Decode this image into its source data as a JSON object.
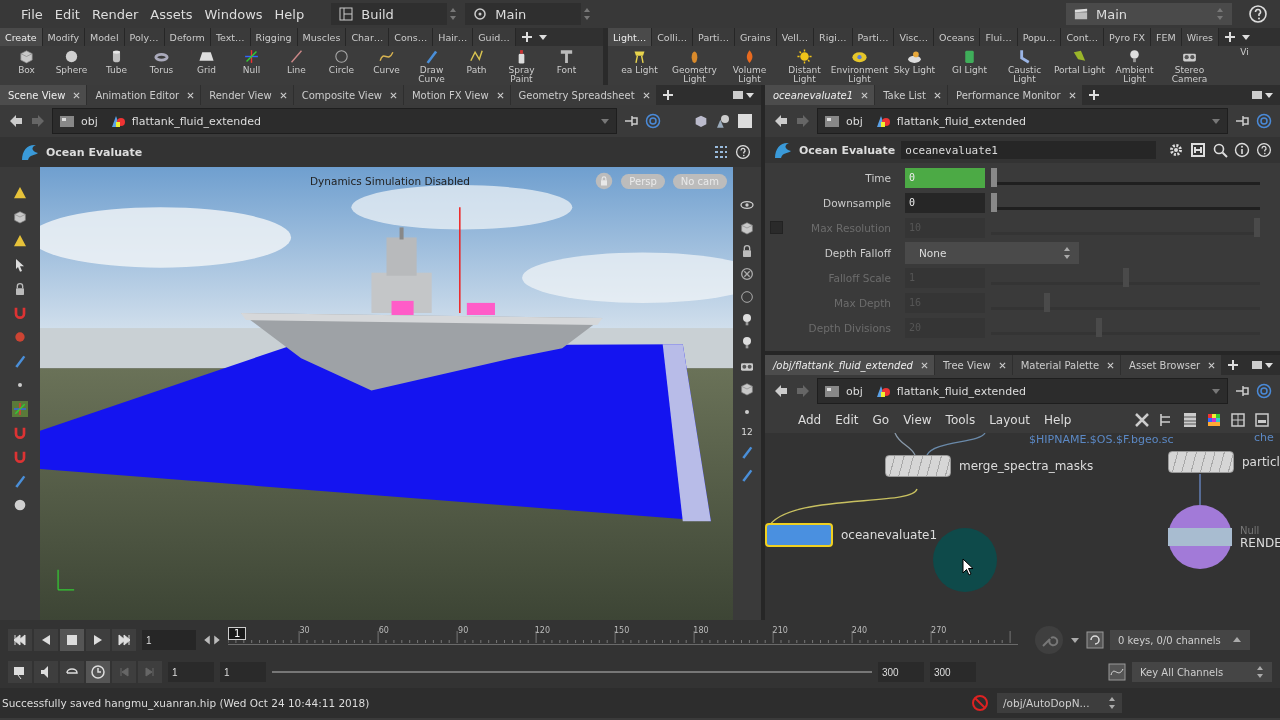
{
  "menubar": {
    "items": [
      "File",
      "Edit",
      "Render",
      "Assets",
      "Windows",
      "Help"
    ],
    "desktop": "Build",
    "scene_view_set": "Main",
    "context": "Main"
  },
  "shelves": [
    {
      "tabs": [
        {
          "label": "Create",
          "selected": true
        },
        {
          "label": "Modify",
          "selected": false
        },
        {
          "label": "Model",
          "selected": false
        },
        {
          "label": "Poly…",
          "selected": false
        },
        {
          "label": "Deform",
          "selected": false
        },
        {
          "label": "Text…",
          "selected": false
        },
        {
          "label": "Rigging",
          "selected": false
        },
        {
          "label": "Muscles",
          "selected": false
        },
        {
          "label": "Char…",
          "selected": false
        },
        {
          "label": "Cons…",
          "selected": false
        },
        {
          "label": "Hair…",
          "selected": false
        },
        {
          "label": "Guid…",
          "selected": false
        }
      ],
      "tools": [
        "Box",
        "Sphere",
        "Tube",
        "Torus",
        "Grid",
        "Null",
        "Line",
        "Circle",
        "Curve",
        "Draw Curve",
        "Path",
        "Spray Paint",
        "Font"
      ]
    },
    {
      "tabs": [
        {
          "label": "Light…",
          "selected": true
        },
        {
          "label": "Colli…",
          "selected": false
        },
        {
          "label": "Parti…",
          "selected": false
        },
        {
          "label": "Grains",
          "selected": false
        },
        {
          "label": "Vell…",
          "selected": false
        },
        {
          "label": "Rigi…",
          "selected": false
        },
        {
          "label": "Parti…",
          "selected": false
        },
        {
          "label": "Visc…",
          "selected": false
        },
        {
          "label": "Oceans",
          "selected": false
        },
        {
          "label": "Flui…",
          "selected": false
        },
        {
          "label": "Popu…",
          "selected": false
        },
        {
          "label": "Cont…",
          "selected": false
        },
        {
          "label": "Pyro FX",
          "selected": false
        },
        {
          "label": "FEM",
          "selected": false
        },
        {
          "label": "Wires",
          "selected": false
        }
      ],
      "tools": [
        "ea Light",
        "Geometry Light",
        "Volume Light",
        "Distant Light",
        "Environment Light",
        "Sky Light",
        "GI Light",
        "Caustic Light",
        "Portal Light",
        "Ambient Light",
        "Stereo Camera",
        "Vi"
      ]
    }
  ],
  "scene_pane": {
    "tabs": [
      {
        "label": "Scene View",
        "selected": true
      },
      {
        "label": "Animation Editor",
        "selected": false
      },
      {
        "label": "Render View",
        "selected": false
      },
      {
        "label": "Composite View",
        "selected": false
      },
      {
        "label": "Motion FX View",
        "selected": false
      },
      {
        "label": "Geometry Spreadsheet",
        "selected": false
      }
    ],
    "path": [
      "obj",
      "flattank_fluid_extended"
    ],
    "node_type": "Ocean Evaluate",
    "overlay": "Dynamics Simulation Disabled",
    "camera_menu": "Persp",
    "cam_menu": "No cam",
    "snap_count": "12"
  },
  "param_pane": {
    "tabs": [
      {
        "label": "oceanevaluate1",
        "selected": true
      },
      {
        "label": "Take List",
        "selected": false
      },
      {
        "label": "Performance Monitor",
        "selected": false
      }
    ],
    "path": [
      "obj",
      "flattank_fluid_extended"
    ],
    "node_type": "Ocean Evaluate",
    "node_name": "oceanevaluate1",
    "params": [
      {
        "kind": "slider",
        "label": "Time",
        "value": "0",
        "level": 0,
        "disabled": false,
        "keyed": true
      },
      {
        "kind": "slider",
        "label": "Downsample",
        "value": "0",
        "level": 0,
        "disabled": false,
        "keyed": false
      },
      {
        "kind": "toggle_slider",
        "label": "Max Resolution",
        "value": "10",
        "level": 1,
        "disabled": true,
        "keyed": false,
        "checked": false
      },
      {
        "kind": "menu",
        "label": "Depth Falloff",
        "value": "None",
        "disabled": false
      },
      {
        "kind": "slider",
        "label": "Falloff Scale",
        "value": "1",
        "level": 0.5,
        "disabled": true,
        "keyed": false
      },
      {
        "kind": "slider",
        "label": "Max Depth",
        "value": "16",
        "level": 0.2,
        "disabled": true,
        "keyed": false
      },
      {
        "kind": "slider",
        "label": "Depth Divisions",
        "value": "20",
        "level": 0.4,
        "disabled": true,
        "keyed": false
      }
    ]
  },
  "network_pane": {
    "tabs": [
      {
        "label": "/obj/flattank_fluid_extended",
        "selected": true
      },
      {
        "label": "Tree View",
        "selected": false
      },
      {
        "label": "Material Palette",
        "selected": false
      },
      {
        "label": "Asset Browser",
        "selected": false
      }
    ],
    "path": [
      "obj",
      "flattank_fluid_extended"
    ],
    "menu": [
      "Add",
      "Edit",
      "Go",
      "View",
      "Tools",
      "Layout",
      "Help"
    ],
    "file_path": "$HIPNAME.$OS.$F.bgeo.sc",
    "partial_label": "che",
    "nodes": [
      {
        "kind": "sop",
        "name": "merge_spectra_masks",
        "selected": false
      },
      {
        "kind": "sop",
        "name": "particl",
        "selected": false
      },
      {
        "kind": "sop",
        "name": "oceanevaluate1",
        "selected": true
      },
      {
        "kind": "null",
        "type": "Null",
        "name": "RENDE",
        "selected": false
      }
    ]
  },
  "timeline": {
    "frame": "1",
    "current_marker": "1",
    "ruler_labels": [
      "30",
      "60",
      "90",
      "120",
      "150",
      "180",
      "210",
      "240",
      "270"
    ],
    "range": [
      "1",
      "1",
      "300",
      "300"
    ],
    "range_slider": {
      "level": 1
    },
    "keys": "0 keys, 0/0 channels",
    "key_mode": "Key All Channels"
  },
  "status_bar": {
    "message": "Successfully saved hangmu_xuanran.hip (Wed Oct 24 10:44:11 2018)",
    "path": "/obj/AutoDopN..."
  }
}
